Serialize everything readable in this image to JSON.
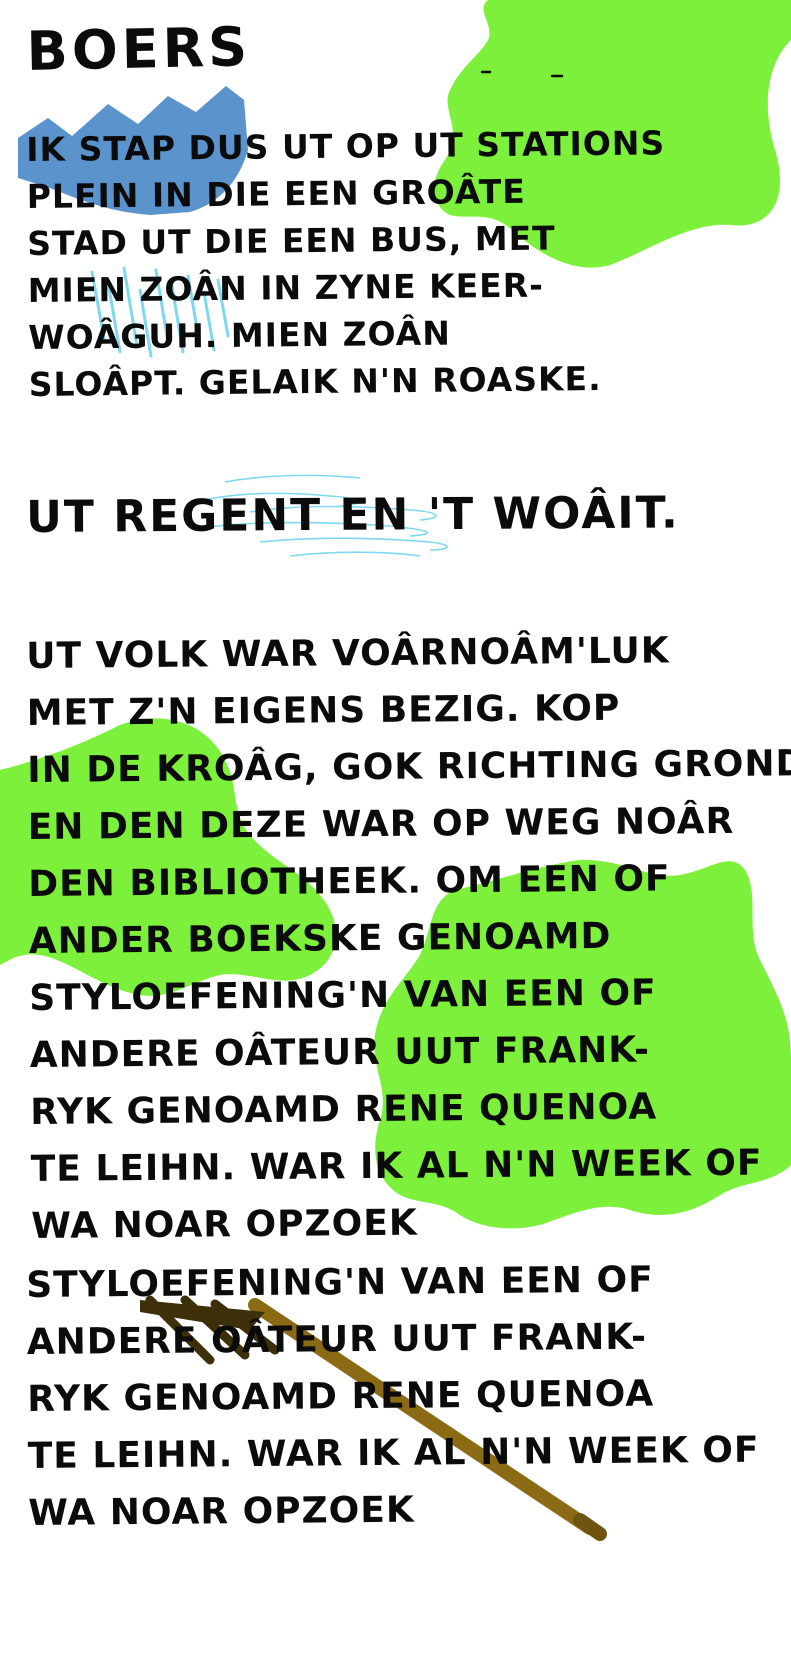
{
  "title": "BOERS",
  "paragraphs": [
    {
      "lines": [
        "Ik stap dus ut op ut Stations",
        "plein in die een groâte",
        "stad ut die een bus, met",
        "mien zoân in zyne keer-",
        "woâguh. Mien zoân",
        "sloâpt. Gelaik n'n roaske."
      ]
    },
    {
      "lines": [
        "ut regent en 't woâit."
      ]
    },
    {
      "lines": [
        "ut volk war voârnoâm'luk",
        "met z'n eigens bezig. kop",
        "in de kroâg, gok richting grond.",
        "en den deze war op weg noâr",
        "den bibliotheek. Om een of",
        "ander boekske genoamd",
        "styloefening'n van een of",
        "andere oâteur uut frank-",
        "ryk genoamd rene quenoa",
        "te leihn. war ik al n'n week of",
        "wa noar opzoek"
      ]
    },
    {
      "lines": [
        "styloefening'n van een of",
        "andere oâteur uut frank-",
        "ryk genoamd rene quenoa",
        "te leihn. war ik al n'n week of",
        "wa noar opzoek"
      ]
    }
  ],
  "colors": {
    "background": "#ffffff",
    "ink": "#0b0b0b",
    "green_blobs": "#7cf03a",
    "blue_zigzag": "#5b93cc",
    "cyan_rain": "#7fd8ee",
    "fork": "#8a6a12"
  },
  "decorations": [
    "green-blob",
    "blue-zigzag",
    "rain-streaks",
    "wind-swirls",
    "pitchfork"
  ]
}
